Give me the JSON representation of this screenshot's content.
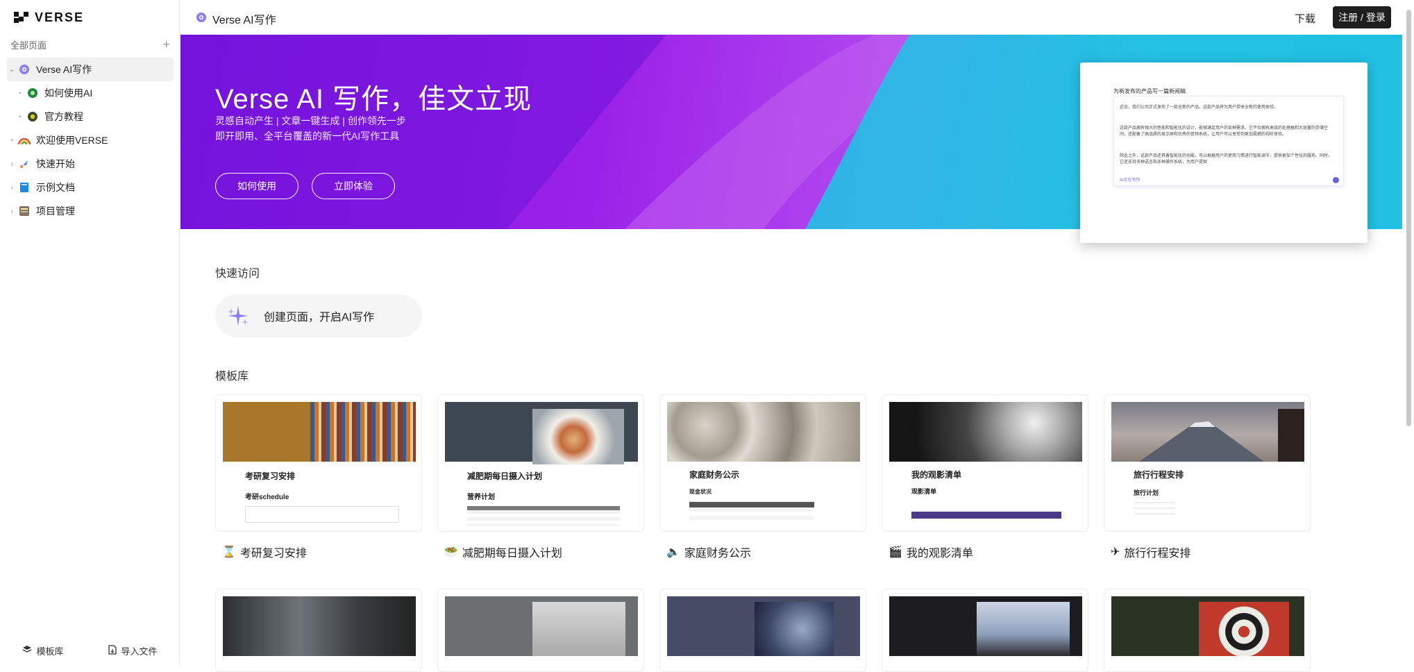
{
  "app": {
    "brand": "VERSE"
  },
  "sidebar": {
    "all_pages_label": "全部页面",
    "add_symbol": "+",
    "items": [
      {
        "label": "Verse AI写作",
        "icon": "gear-flower-icon",
        "expanded": true,
        "active": true
      },
      {
        "label": "如何使用AI",
        "icon": "green-gear-icon",
        "child": true
      },
      {
        "label": "官方教程",
        "icon": "sun-gear-icon",
        "child": true
      },
      {
        "label": "欢迎使用VERSE",
        "icon": "rainbow-icon"
      },
      {
        "label": "快速开始",
        "icon": "rocket-icon"
      },
      {
        "label": "示例文档",
        "icon": "book-icon"
      },
      {
        "label": "项目管理",
        "icon": "ledger-icon"
      }
    ],
    "bottom": {
      "templates_label": "模板库",
      "import_label": "导入文件"
    }
  },
  "topbar": {
    "title": "Verse AI写作",
    "download_label": "下载",
    "login_label": "注册 / 登录"
  },
  "hero": {
    "title": "Verse AI 写作，佳文立现",
    "subtitle_line1": "灵感自动产生 | 文章一键生成 | 创作领先一步",
    "subtitle_line2": "即开即用、全平台覆盖的新一代AI写作工具",
    "btn_how": "如何使用",
    "btn_try": "立即体验",
    "preview": {
      "title": "为新发布的产品写一篇新闻稿",
      "p1": "近日，我们公司正式发布了一款全新的产品。这款产品将为用户带来全新的使用体验。",
      "p2": "这款产品拥有强大的性能和智能化的设计，能够满足用户的各种需求。它不仅拥有高效的处理器和大容量的存储空间，还配备了高品质的显示屏和优秀的音频系统，让用户可以享受到更加震撼的视听体验。",
      "p3": "除此之外，这款产品还具备智能化的功能，可以根据用户的使用习惯进行智能调节，提供更加个性化的服务。同时，它还支持多种语言和多种操作系统，为用户提供",
      "footer": "AI正在写作"
    }
  },
  "quick": {
    "title": "快速访问",
    "create_label": "创建页面，开启AI写作"
  },
  "templates": {
    "title": "模板库",
    "row1": [
      {
        "label": "考研复习安排",
        "icon_glyph": "⌛",
        "heading": "考研复习安排",
        "sub": "考研schedule"
      },
      {
        "label": "减肥期每日摄入计划",
        "icon_glyph": "🥗",
        "heading": "减肥期每日摄入计划",
        "sub": "营养计划"
      },
      {
        "label": "家庭财务公示",
        "icon_glyph": "🔈",
        "heading": "家庭财务公示",
        "sub": "现金状况"
      },
      {
        "label": "我的观影清单",
        "icon_glyph": "🎬",
        "heading": "我的观影清单",
        "sub": "观影清单"
      },
      {
        "label": "旅行行程安排",
        "icon_glyph": "✈",
        "heading": "旅行行程安排",
        "sub": "旅行计划"
      }
    ]
  },
  "colors": {
    "accent_purple": "#7a14e0",
    "accent_cyan": "#1fc0e0",
    "login_bg": "#1e1e1e"
  }
}
